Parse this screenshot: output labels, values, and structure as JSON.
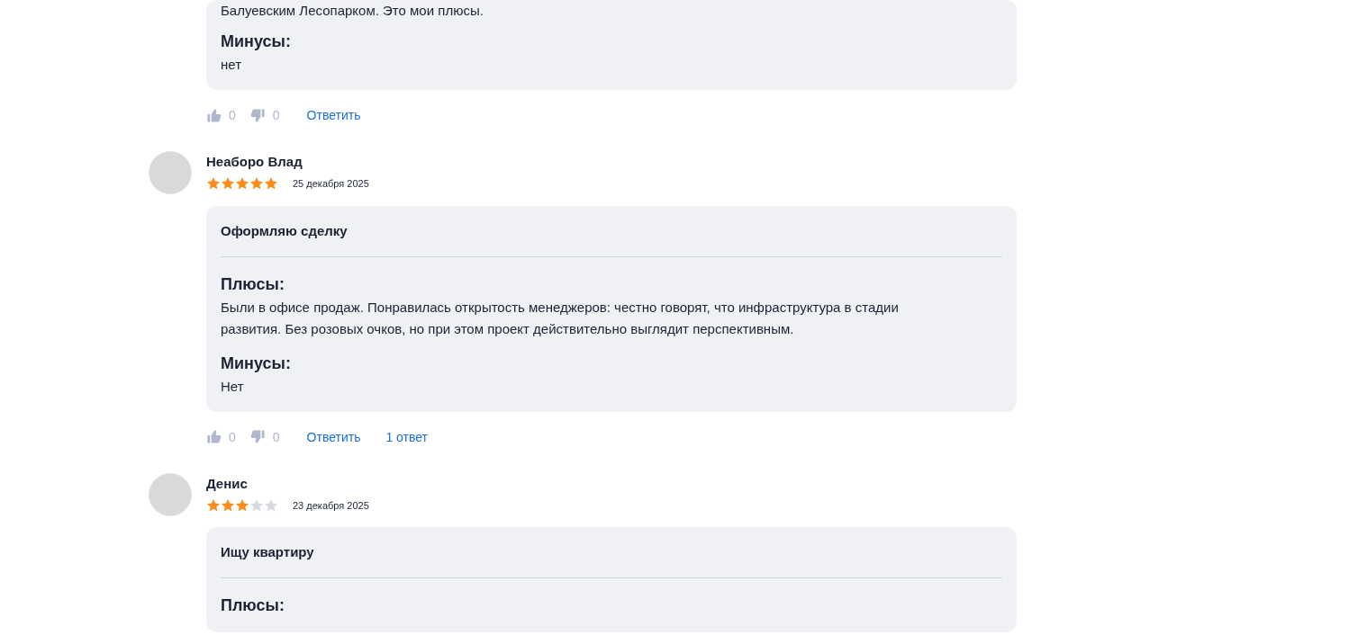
{
  "reviews": [
    {
      "pros_tail": "Балуевским Лесопарком. Это мои плюсы.",
      "cons_label": "Минусы:",
      "cons": "нет",
      "likes": "0",
      "dislikes": "0",
      "reply": "Ответить"
    },
    {
      "author": "Неаборо Влад",
      "stars": 5,
      "date": "25 декабря 2025",
      "title": "Оформляю сделку",
      "pros_label": "Плюсы:",
      "pros": "Были в офисе продаж. Понравилась открытость менеджеров: честно говорят, что инфраструктура в стадии развития. Без розовых очков, но при этом проект действительно выглядит перспективным.",
      "cons_label": "Минусы:",
      "cons": "Нет",
      "likes": "0",
      "dislikes": "0",
      "reply": "Ответить",
      "answers": "1 ответ"
    },
    {
      "author": "Денис",
      "stars": 3,
      "date": "23 декабря 2025",
      "title": "Ищу квартиру",
      "pros_label": "Плюсы:"
    }
  ]
}
